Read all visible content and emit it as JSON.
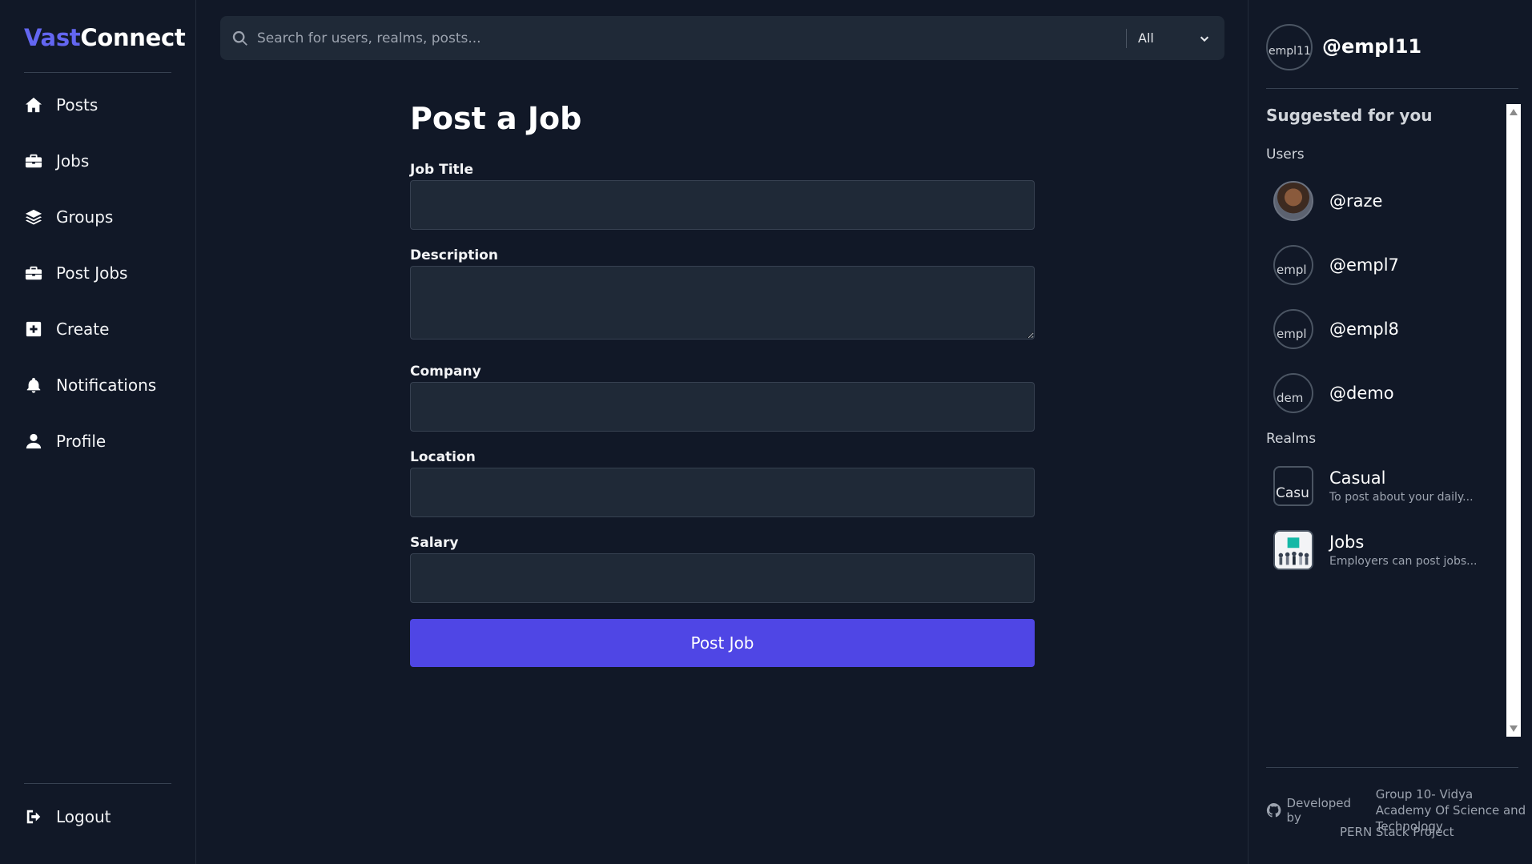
{
  "brand": {
    "part1": "Vast",
    "part2": "Connect",
    "accent_color": "#6366f1"
  },
  "nav": {
    "items": [
      {
        "label": "Posts",
        "icon": "home-icon"
      },
      {
        "label": "Jobs",
        "icon": "briefcase-icon"
      },
      {
        "label": "Groups",
        "icon": "layers-icon"
      },
      {
        "label": "Post Jobs",
        "icon": "briefcase-icon"
      },
      {
        "label": "Create",
        "icon": "plus-square-icon"
      },
      {
        "label": "Notifications",
        "icon": "bell-icon"
      },
      {
        "label": "Profile",
        "icon": "user-icon"
      }
    ],
    "logout": {
      "label": "Logout",
      "icon": "logout-icon"
    }
  },
  "search": {
    "placeholder": "Search for users, realms, posts...",
    "value": "",
    "filter": "All"
  },
  "form": {
    "title": "Post a Job",
    "fields": [
      {
        "label": "Job Title",
        "value": ""
      },
      {
        "label": "Description",
        "value": ""
      },
      {
        "label": "Company",
        "value": ""
      },
      {
        "label": "Location",
        "value": ""
      },
      {
        "label": "Salary",
        "value": ""
      }
    ],
    "submit": "Post Job",
    "submit_color": "#4f46e5"
  },
  "profile": {
    "handle": "@empl11",
    "avatar_alt": "empl11"
  },
  "suggestions": {
    "title": "Suggested for you",
    "users_heading": "Users",
    "users": [
      {
        "handle": "@raze",
        "avatar_alt": ""
      },
      {
        "handle": "@empl7",
        "avatar_alt": "empl"
      },
      {
        "handle": "@empl8",
        "avatar_alt": "empl"
      },
      {
        "handle": "@demo",
        "avatar_alt": "dem"
      }
    ],
    "realms_heading": "Realms",
    "realms": [
      {
        "name": "Casual",
        "description": "To post about your daily...",
        "avatar_alt": "Casu"
      },
      {
        "name": "Jobs",
        "description": "Employers can post jobs...",
        "avatar_alt": ""
      }
    ]
  },
  "footer": {
    "developed_by": "Developed by",
    "group": "Group 10- Vidya Academy Of Science and Technology",
    "project": "PERN Stack Project"
  }
}
